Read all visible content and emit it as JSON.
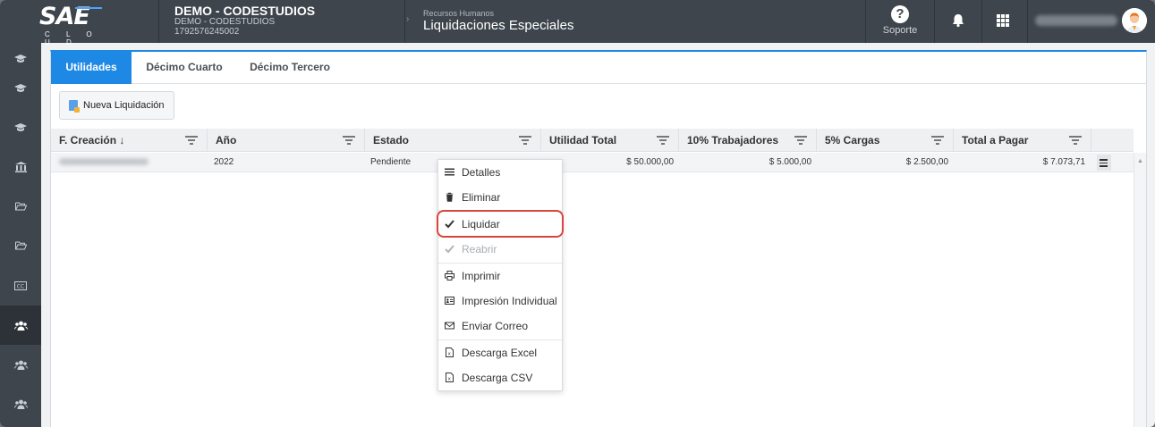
{
  "header": {
    "logo_text": "SAE",
    "logo_sub": "C L O U D",
    "company_name": "DEMO - CODESTUDIOS",
    "company_sub": "DEMO - CODESTUDIOS",
    "company_ruc": "1792576245002",
    "module": "Recursos Humanos",
    "page_title": "Liquidaciones Especiales",
    "support_label": "Soporte"
  },
  "tabs": [
    {
      "label": "Utilidades",
      "active": true
    },
    {
      "label": "Décimo Cuarto",
      "active": false
    },
    {
      "label": "Décimo Tercero",
      "active": false
    }
  ],
  "toolbar": {
    "new_button": "Nueva Liquidación"
  },
  "table": {
    "columns": [
      "F. Creación ↓",
      "Año",
      "Estado",
      "Utilidad Total",
      "10% Trabajadores",
      "5% Cargas",
      "Total a Pagar"
    ],
    "rows": [
      {
        "year": "2022",
        "status": "Pendiente",
        "utilidad_total": "$ 50.000,00",
        "trabajadores": "$ 5.000,00",
        "cargas": "$ 2.500,00",
        "total": "$ 7.073,71"
      }
    ]
  },
  "context_menu": [
    {
      "label": "Detalles",
      "icon": "list-icon",
      "disabled": false
    },
    {
      "label": "Eliminar",
      "icon": "trash-icon",
      "disabled": false
    },
    {
      "label": "Liquidar",
      "icon": "check-icon",
      "disabled": false,
      "highlighted": true
    },
    {
      "label": "Reabrir",
      "icon": "check-icon",
      "disabled": true
    },
    {
      "label": "Imprimir",
      "icon": "printer-icon",
      "disabled": false
    },
    {
      "label": "Impresión Individual",
      "icon": "id-card-icon",
      "disabled": false
    },
    {
      "label": "Enviar Correo",
      "icon": "envelope-icon",
      "disabled": false
    },
    {
      "label": "Descarga Excel",
      "icon": "excel-file-icon",
      "disabled": false
    },
    {
      "label": "Descarga CSV",
      "icon": "csv-file-icon",
      "disabled": false
    }
  ],
  "colors": {
    "accent": "#1e88e5",
    "topbar": "#3e454c",
    "highlight": "#d9453b"
  }
}
